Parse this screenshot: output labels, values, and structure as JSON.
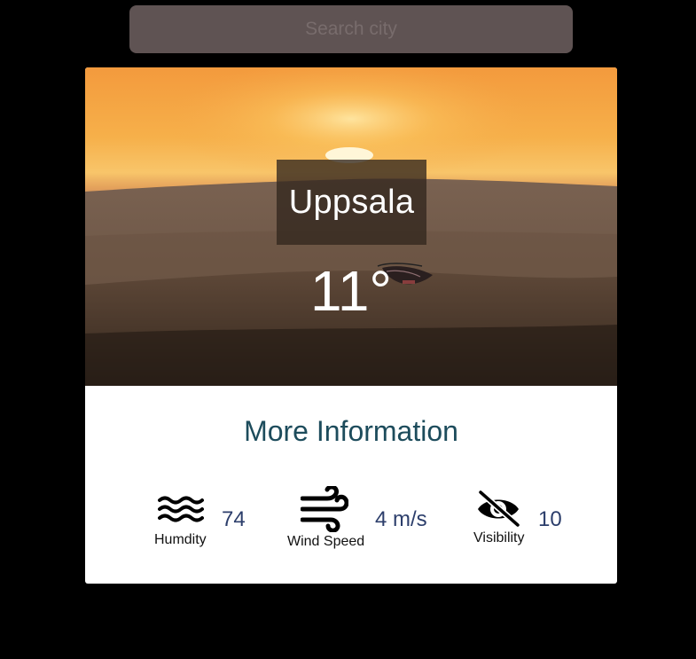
{
  "search": {
    "placeholder": "Search city"
  },
  "weather": {
    "city": "Uppsala",
    "temperature": "11°"
  },
  "more_info": {
    "title": "More Information",
    "humidity": {
      "label": "Humdity",
      "value": "74",
      "icon": "waves-icon"
    },
    "wind": {
      "label": "Wind Speed",
      "value": "4 m/s",
      "icon": "wind-icon"
    },
    "visibility": {
      "label": "Visibility",
      "value": "10",
      "icon": "eye-slash-icon"
    }
  },
  "colors": {
    "page_background": "#000000",
    "search_background": "#5f5353",
    "card_background": "#ffffff",
    "title_color": "#1d4c5c",
    "value_color": "#2c3e6b"
  }
}
